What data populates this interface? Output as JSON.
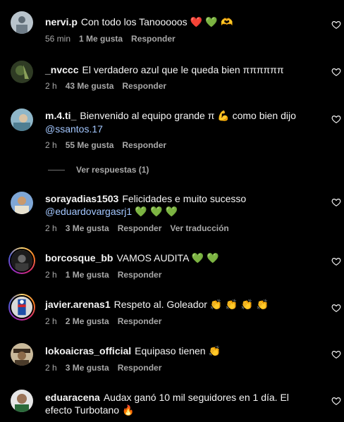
{
  "comments": [
    {
      "user": "nervi.p",
      "text": "Con todo los Tanooooos",
      "emoji": "❤️ 💚 🫶",
      "time": "56 min",
      "likes": "1 Me gusta",
      "reply": "Responder"
    },
    {
      "user": "_nvccc",
      "text": "El verdadero azul que le queda bien ππππππ",
      "time": "2 h",
      "likes": "43 Me gusta",
      "reply": "Responder"
    },
    {
      "user": "m.4.ti_",
      "text": "Bienvenido al equipo grande π",
      "emoji": "💪",
      "text2": "como bien dijo",
      "mention": "@ssantos.17",
      "time": "2 h",
      "likes": "55 Me gusta",
      "reply": "Responder",
      "view_replies": "Ver respuestas (1)"
    },
    {
      "user": "sorayadias1503",
      "text": "Felicidades e muito sucesso",
      "mention": "@eduardovargasrj1",
      "emoji": "💚 💚 💚",
      "time": "2 h",
      "likes": "3 Me gusta",
      "reply": "Responder",
      "translate": "Ver traducción"
    },
    {
      "user": "borcosque_bb",
      "text": "VAMOS AUDITA",
      "emoji": "💚 💚",
      "time": "2 h",
      "likes": "1 Me gusta",
      "reply": "Responder"
    },
    {
      "user": "javier.arenas1",
      "text": "Respeto al. Goleador",
      "emoji": "👏 👏 👏 👏",
      "time": "2 h",
      "likes": "2 Me gusta",
      "reply": "Responder"
    },
    {
      "user": "lokoaicras_official",
      "text": "Equipaso tienen",
      "emoji": "👏",
      "time": "2 h",
      "likes": "3 Me gusta",
      "reply": "Responder"
    },
    {
      "user": "eduaracena",
      "text": "Audax ganó 10 mil seguidores en 1 día. El efecto Turbotano",
      "emoji": "🔥"
    }
  ]
}
